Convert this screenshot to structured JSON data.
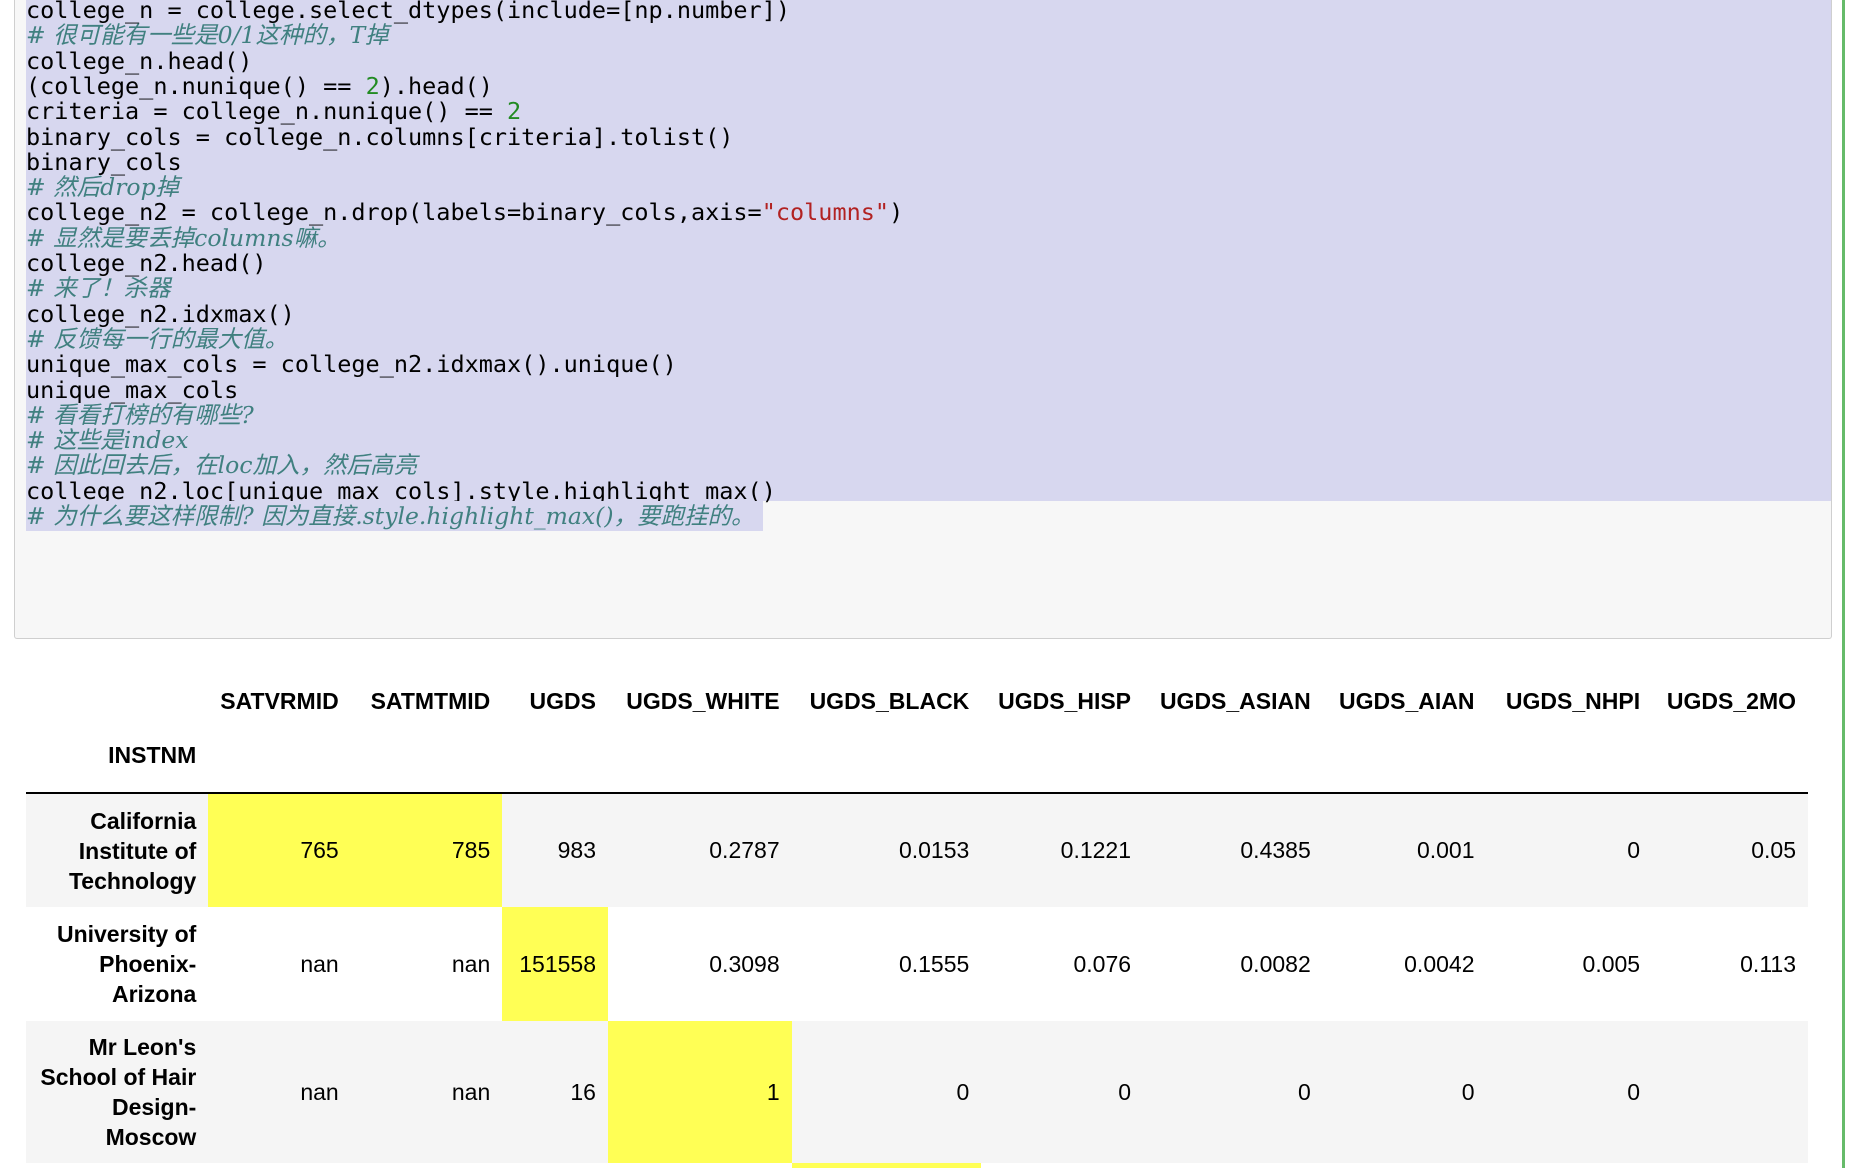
{
  "code_cell": {
    "lines": [
      [
        {
          "t": "college_n = college.select_dtypes(include=[np.number])",
          "c": ""
        }
      ],
      [
        {
          "t": "# 很可能有一些是0/1这种的，T掉",
          "c": "cmt"
        }
      ],
      [
        {
          "t": "college_n.head()",
          "c": ""
        }
      ],
      [
        {
          "t": "(college_n.nunique() == ",
          "c": ""
        },
        {
          "t": "2",
          "c": "num"
        },
        {
          "t": ").head()",
          "c": ""
        }
      ],
      [
        {
          "t": "criteria = college_n.nunique() == ",
          "c": ""
        },
        {
          "t": "2",
          "c": "num"
        }
      ],
      [
        {
          "t": "binary_cols = college_n.columns[criteria].tolist()",
          "c": ""
        }
      ],
      [
        {
          "t": "binary_cols",
          "c": ""
        }
      ],
      [
        {
          "t": "# 然后drop掉",
          "c": "cmt"
        }
      ],
      [
        {
          "t": "college_n2 = college_n.drop(labels=binary_cols,axis=",
          "c": ""
        },
        {
          "t": "\"columns\"",
          "c": "str"
        },
        {
          "t": ")",
          "c": ""
        }
      ],
      [
        {
          "t": "# 显然是要丢掉columns嘛。",
          "c": "cmt"
        }
      ],
      [
        {
          "t": "college_n2.head()",
          "c": ""
        }
      ],
      [
        {
          "t": "# 来了！杀器",
          "c": "cmt"
        }
      ],
      [
        {
          "t": "college_n2.idxmax()",
          "c": ""
        }
      ],
      [
        {
          "t": "# 反馈每一行的最大值。",
          "c": "cmt"
        }
      ],
      [
        {
          "t": "unique_max_cols = college_n2.idxmax().unique()",
          "c": ""
        }
      ],
      [
        {
          "t": "unique_max_cols",
          "c": ""
        }
      ],
      [
        {
          "t": "# 看看打榜的有哪些?",
          "c": "cmt"
        }
      ],
      [
        {
          "t": "# 这些是index",
          "c": "cmt"
        }
      ],
      [
        {
          "t": "# 因此回去后，在loc加入，然后高亮",
          "c": "cmt"
        }
      ],
      [
        {
          "t": "college_n2.loc[unique_max_cols].style.highlight_max()",
          "c": ""
        }
      ],
      [
        {
          "t": "# 为什么要这样限制? 因为直接.style.highlight_max()，要跑挂的。",
          "c": "cmt"
        }
      ]
    ]
  },
  "output_table": {
    "index_name": "INSTNM",
    "columns": [
      "SATVRMID",
      "SATMTMID",
      "UGDS",
      "UGDS_WHITE",
      "UGDS_BLACK",
      "UGDS_HISP",
      "UGDS_ASIAN",
      "UGDS_AIAN",
      "UGDS_NHPI",
      "UGDS_2MO"
    ],
    "rows": [
      {
        "index": "California Institute of Technology",
        "values": [
          "765",
          "785",
          "983",
          "0.2787",
          "0.0153",
          "0.1221",
          "0.4385",
          "0.001",
          "0",
          "0.05"
        ],
        "highlight": [
          true,
          true,
          false,
          false,
          false,
          false,
          false,
          false,
          false,
          false
        ]
      },
      {
        "index": "University of Phoenix-Arizona",
        "values": [
          "nan",
          "nan",
          "151558",
          "0.3098",
          "0.1555",
          "0.076",
          "0.0082",
          "0.0042",
          "0.005",
          "0.113"
        ],
        "highlight": [
          false,
          false,
          true,
          false,
          false,
          false,
          false,
          false,
          false,
          false
        ]
      },
      {
        "index": "Mr Leon's School of Hair Design-Moscow",
        "values": [
          "nan",
          "nan",
          "16",
          "1",
          "0",
          "0",
          "0",
          "0",
          "0",
          ""
        ],
        "highlight": [
          false,
          false,
          false,
          true,
          false,
          false,
          false,
          false,
          false,
          false
        ]
      },
      {
        "index": "",
        "values": [
          "",
          "",
          "",
          "",
          "",
          "",
          "",
          "",
          "",
          ""
        ],
        "highlight": [
          false,
          false,
          false,
          false,
          true,
          false,
          false,
          false,
          false,
          false
        ]
      }
    ],
    "highlight_color": "#ffff55",
    "stripe_color": "#f5f5f5"
  },
  "colors": {
    "selection": "#d7d7ef",
    "comment": "#408080",
    "number": "#228b22",
    "string": "#b22222",
    "cell_edge": "#66bb6a"
  }
}
